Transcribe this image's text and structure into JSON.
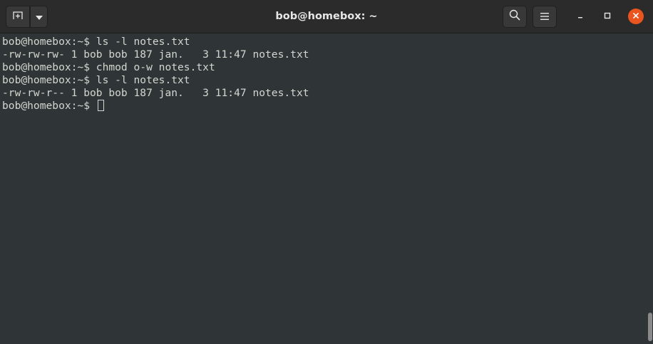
{
  "window": {
    "title": "bob@homebox: ~"
  },
  "titlebar": {
    "icons": {
      "new_tab": "new-tab-icon",
      "dropdown": "chevron-down-icon",
      "search": "search-icon",
      "menu": "hamburger-menu-icon",
      "minimize": "minimize-icon",
      "maximize": "maximize-icon",
      "close": "close-icon"
    }
  },
  "terminal": {
    "lines": [
      "bob@homebox:~$ ls -l notes.txt",
      "-rw-rw-rw- 1 bob bob 187 jan.   3 11:47 notes.txt",
      "bob@homebox:~$ chmod o-w notes.txt",
      "bob@homebox:~$ ls -l notes.txt",
      "-rw-rw-r-- 1 bob bob 187 jan.   3 11:47 notes.txt"
    ],
    "prompt": "bob@homebox:~$ "
  },
  "colors": {
    "titlebar_bg": "#2b2b2b",
    "terminal_bg": "#2f3437",
    "text": "#d3d7cf",
    "close_button": "#e9541f"
  }
}
